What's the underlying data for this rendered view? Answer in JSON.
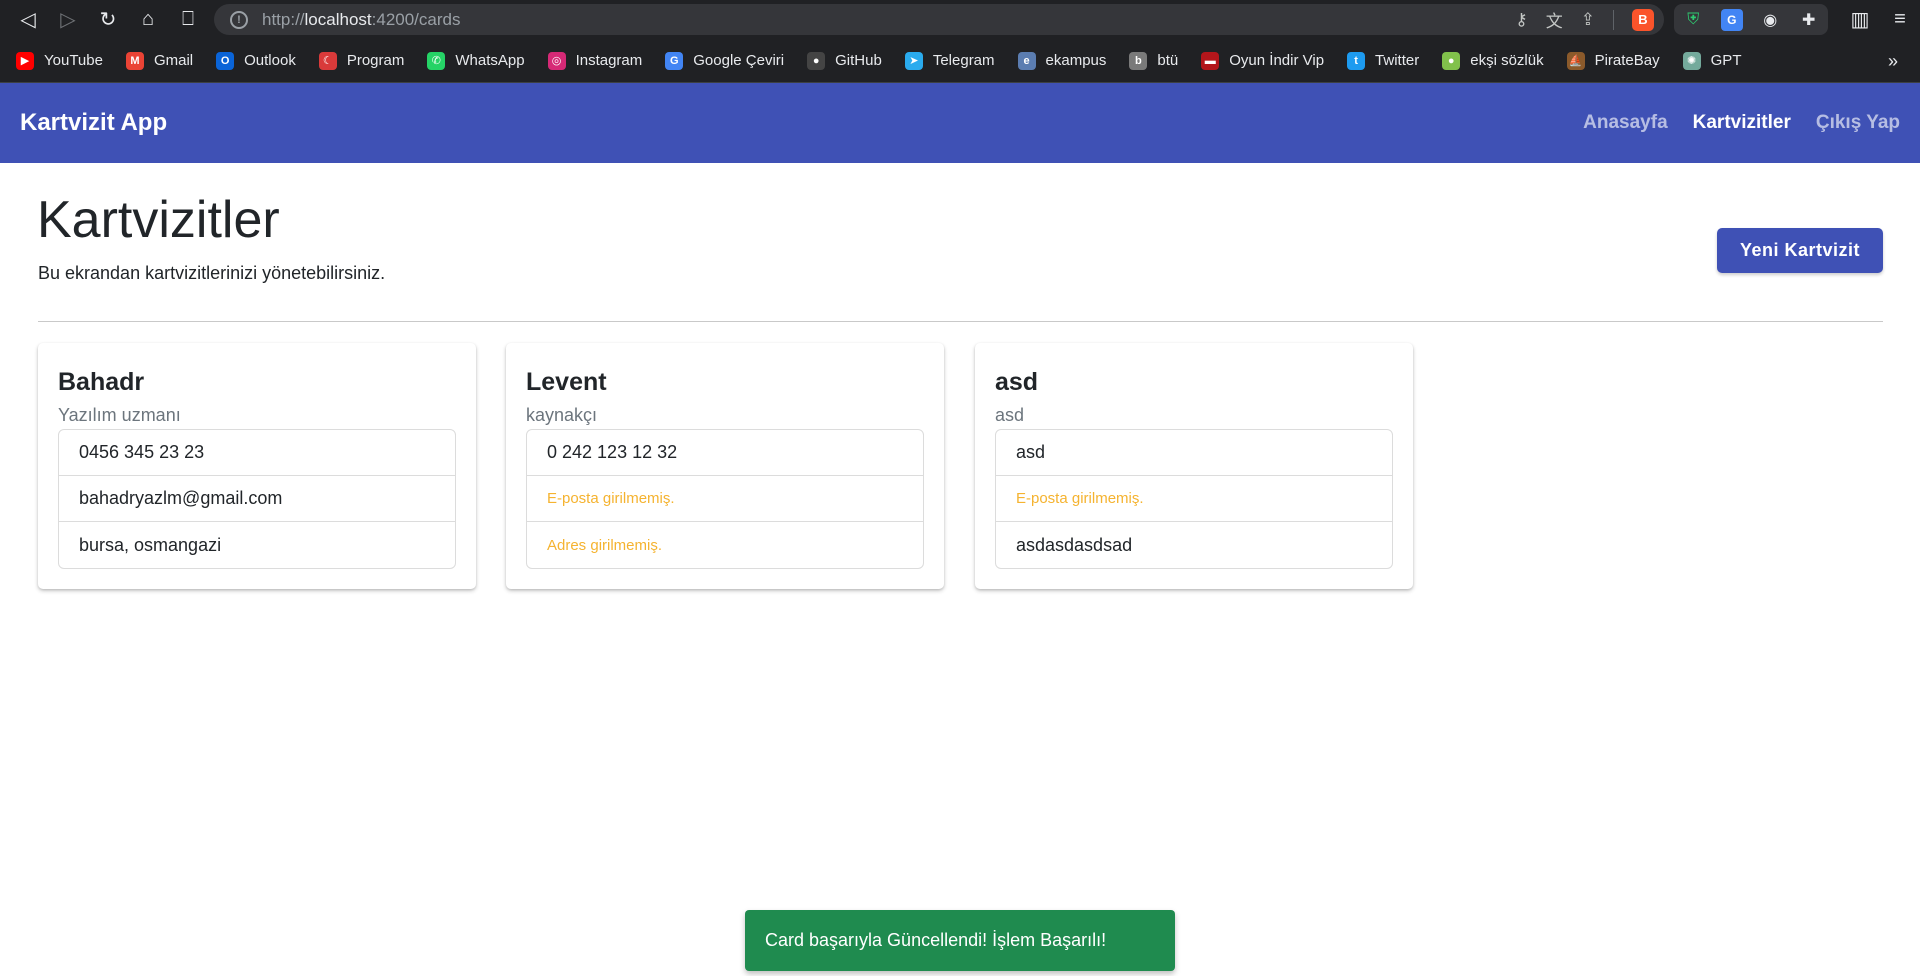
{
  "browser": {
    "url_scheme": "http://",
    "url_host": "localhost",
    "url_rest": ":4200/cards"
  },
  "bookmarks": [
    {
      "label": "YouTube",
      "icon": "youtube-icon",
      "color": "#ff0000",
      "glyph": "▶"
    },
    {
      "label": "Gmail",
      "icon": "gmail-icon",
      "color": "#ea4335",
      "glyph": "M"
    },
    {
      "label": "Outlook",
      "icon": "outlook-icon",
      "color": "#0a64d8",
      "glyph": "O"
    },
    {
      "label": "Program",
      "icon": "program-icon",
      "color": "#d93a3a",
      "glyph": "☾"
    },
    {
      "label": "WhatsApp",
      "icon": "whatsapp-icon",
      "color": "#25d366",
      "glyph": "✆"
    },
    {
      "label": "Instagram",
      "icon": "instagram-icon",
      "color": "#d62976",
      "glyph": "◎"
    },
    {
      "label": "Google Çeviri",
      "icon": "google-translate-icon",
      "color": "#4285f4",
      "glyph": "G"
    },
    {
      "label": "GitHub",
      "icon": "github-icon",
      "color": "#444444",
      "glyph": "●"
    },
    {
      "label": "Telegram",
      "icon": "telegram-icon",
      "color": "#2aabee",
      "glyph": "➤"
    },
    {
      "label": "ekampus",
      "icon": "ekampus-icon",
      "color": "#5b7db1",
      "glyph": "e"
    },
    {
      "label": "btü",
      "icon": "btu-icon",
      "color": "#7a7a7a",
      "glyph": "b"
    },
    {
      "label": "Oyun İndir Vip",
      "icon": "game-icon",
      "color": "#b3161b",
      "glyph": "▬"
    },
    {
      "label": "Twitter",
      "icon": "twitter-icon",
      "color": "#1d9bf0",
      "glyph": "t"
    },
    {
      "label": "ekşi sözlük",
      "icon": "eksi-icon",
      "color": "#81c14b",
      "glyph": "●"
    },
    {
      "label": "PirateBay",
      "icon": "piratebay-icon",
      "color": "#8b5a2b",
      "glyph": "⛵"
    },
    {
      "label": "GPT",
      "icon": "gpt-icon",
      "color": "#74aa9c",
      "glyph": "✺"
    }
  ],
  "navbar": {
    "brand": "Kartvizit App",
    "links": [
      "Anasayfa",
      "Kartvizitler",
      "Çıkış Yap"
    ]
  },
  "page": {
    "title": "Kartvizitler",
    "subtitle": "Bu ekrandan kartvizitlerinizi yönetebilirsiniz.",
    "new_button": "Yeni Kartvizit"
  },
  "cards": [
    {
      "name": "Bahadr",
      "title": "Yazılım uzmanı",
      "phone": "0456 345 23 23",
      "email": "bahadryazlm@gmail.com",
      "address": "bursa, osmangazi"
    },
    {
      "name": "Levent",
      "title": "kaynakçı",
      "phone": "0 242 123 12 32",
      "email": "E-posta girilmemiş.",
      "address": "Adres girilmemiş."
    },
    {
      "name": "asd",
      "title": "asd",
      "phone": "asd",
      "email": "E-posta girilmemiş.",
      "address": "asdasdasdsad"
    }
  ],
  "toast": {
    "message": "Card başarıyla Güncellendi! İşlem Başarılı!",
    "color": "#1f8b4f"
  },
  "colors": {
    "primary": "#3f51b5",
    "warning_text": "#f5b330"
  }
}
